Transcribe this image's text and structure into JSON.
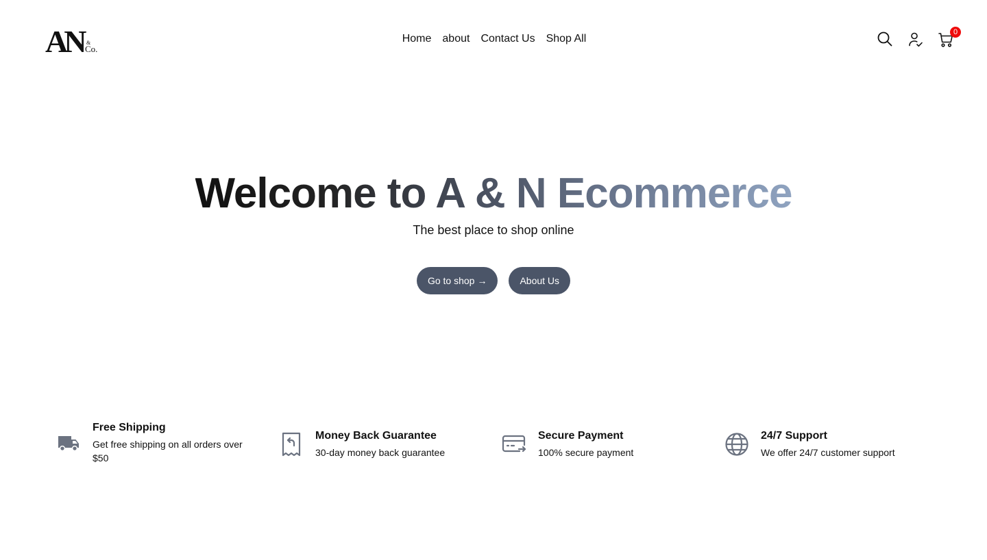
{
  "header": {
    "logo": {
      "main": "AN",
      "sub_top": "&",
      "sub_bottom": "Co."
    },
    "nav": [
      {
        "label": "Home"
      },
      {
        "label": "about"
      },
      {
        "label": "Contact Us"
      },
      {
        "label": "Shop All"
      }
    ],
    "icons": {
      "search": "search-icon",
      "account": "user-check-icon",
      "cart": "cart-icon"
    },
    "cart_count": "0"
  },
  "hero": {
    "title": "Welcome to A & N Ecommerce",
    "subtitle": "The best place to shop online",
    "primary_button": "Go to shop",
    "primary_button_arrow": "→",
    "secondary_button": "About Us"
  },
  "features": [
    {
      "icon": "truck-icon",
      "title": "Free Shipping",
      "desc": "Get free shipping on all orders over $50"
    },
    {
      "icon": "receipt-refund-icon",
      "title": "Money Back Guarantee",
      "desc": "30-day money back guarantee"
    },
    {
      "icon": "credit-card-icon",
      "title": "Secure Payment",
      "desc": "100% secure payment"
    },
    {
      "icon": "globe-icon",
      "title": "24/7 Support",
      "desc": "We offer 24/7 customer support"
    }
  ],
  "colors": {
    "button_bg": "#4b5568",
    "badge_bg": "#ef0b0b",
    "icon_gray": "#6b7280"
  }
}
